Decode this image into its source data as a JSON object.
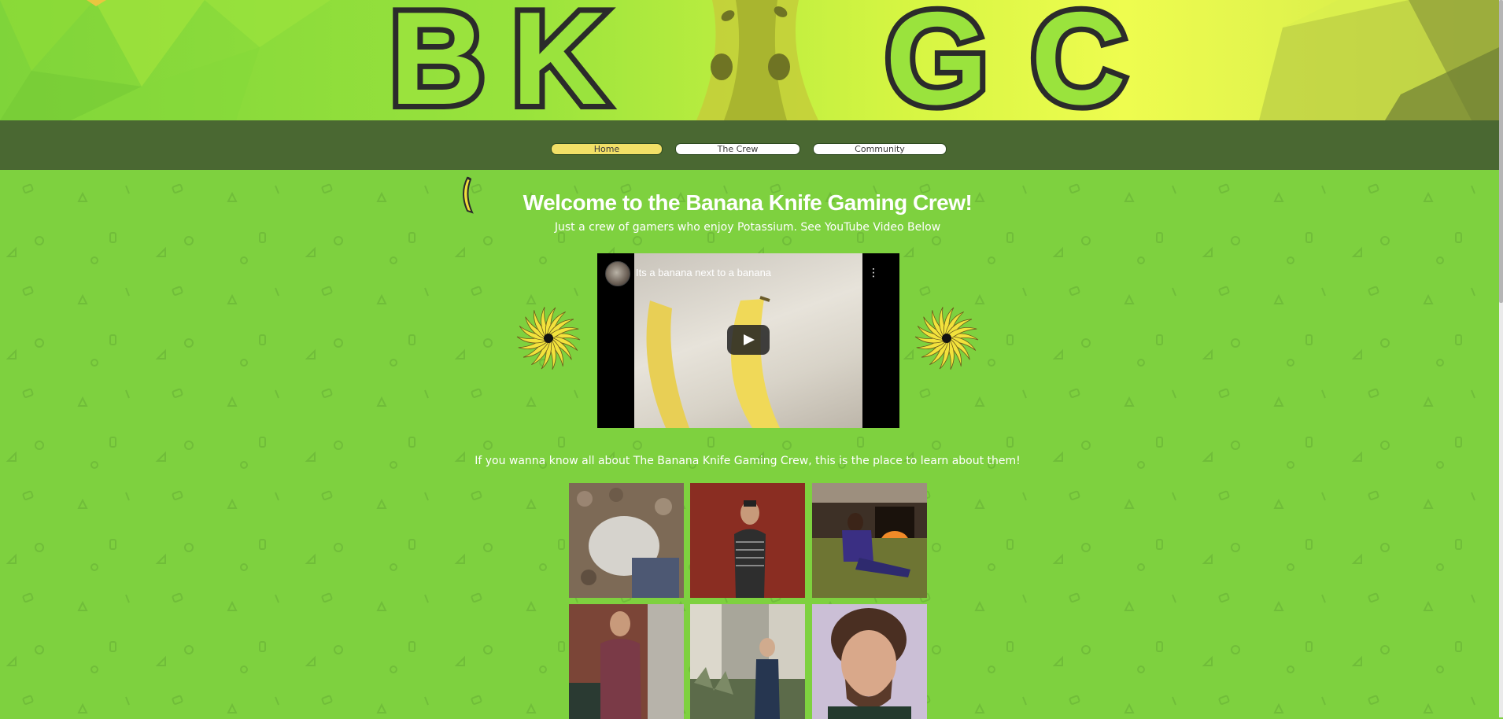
{
  "header": {
    "logo_letters": [
      "B",
      "K",
      "G",
      "C"
    ]
  },
  "nav": {
    "items": [
      {
        "label": "Home",
        "active": true
      },
      {
        "label": "The Crew",
        "active": false
      },
      {
        "label": "Community",
        "active": false
      }
    ]
  },
  "main": {
    "title": "Welcome to the Banana Knife Gaming Crew!",
    "subtitle": "Just a crew of gamers who enjoy Potassium. See YouTube Video Below",
    "video": {
      "title": "Its a banana next to a banana"
    },
    "intro": "If you wanna know all about The Banana Knife Gaming Crew, this is the place to learn about them!",
    "gallery": [
      {
        "name": "photo-person-lying-on-floor"
      },
      {
        "name": "photo-person-red-wall"
      },
      {
        "name": "photo-person-by-fireplace"
      },
      {
        "name": "photo-person-brick-alley"
      },
      {
        "name": "photo-person-garden"
      },
      {
        "name": "photo-person-portrait"
      }
    ]
  },
  "colors": {
    "page_bg": "#7ed13f",
    "nav_bg": "#4a6832",
    "nav_active": "#f2e067",
    "logo_dark": "#2b2b2b"
  }
}
